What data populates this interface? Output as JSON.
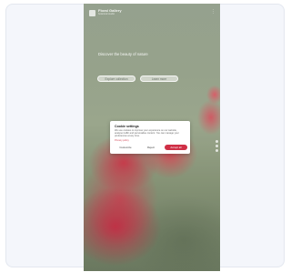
{
  "page": {
    "brand": {
      "name": "Floral Gallery",
      "subtitle": "botanical studio"
    },
    "headline": "Discover the beauty of nature",
    "pills": [
      "Explore collection",
      "Learn more"
    ],
    "menu_glyph": "⋮"
  },
  "cookie_dialog": {
    "title": "Cookie settings",
    "body": "We use cookies to improve your experience on our website, analyse traffic and personalise content. You can manage your preferences at any time.",
    "link": "Privacy policy",
    "buttons": {
      "settings": "Customize",
      "reject": "Reject",
      "accept": "Accept all"
    }
  },
  "colors": {
    "accent": "#cf2f46",
    "flower": "#c4283c",
    "background": "#8f9c84",
    "card": "#f4f6fb"
  }
}
